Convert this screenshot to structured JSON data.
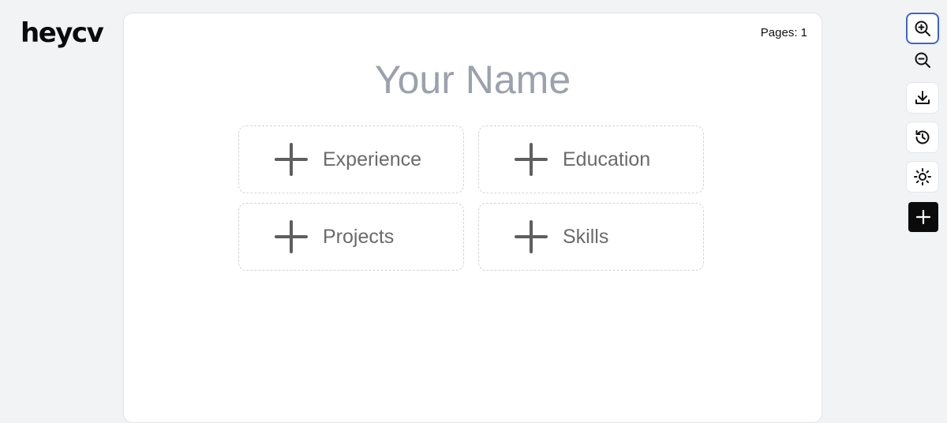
{
  "app": {
    "logo": "heycv"
  },
  "document": {
    "pages_label": "Pages: 1",
    "name_placeholder": "Your Name",
    "sections": [
      {
        "label": "Experience",
        "icon": "plus-icon"
      },
      {
        "label": "Education",
        "icon": "plus-icon"
      },
      {
        "label": "Projects",
        "icon": "plus-icon"
      },
      {
        "label": "Skills",
        "icon": "plus-icon"
      }
    ]
  },
  "toolbar": {
    "items": [
      {
        "icon": "zoom-in-icon",
        "state": "focused"
      },
      {
        "icon": "zoom-out-icon"
      },
      {
        "icon": "download-icon"
      },
      {
        "icon": "history-icon"
      },
      {
        "icon": "sun-icon"
      },
      {
        "icon": "plus-icon"
      }
    ]
  },
  "colors": {
    "background": "#f2f3f5",
    "page": "#ffffff",
    "name_placeholder": "#9ba1ad",
    "section_text": "#6b6b6b",
    "focus_border": "#3b67c9",
    "add_button": "#0b0b0b"
  }
}
